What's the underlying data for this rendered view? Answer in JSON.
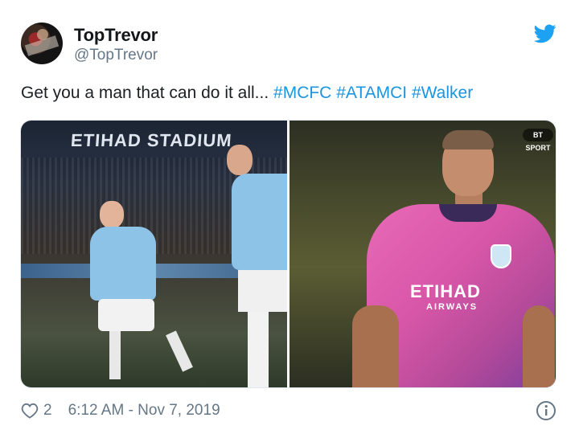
{
  "tweet": {
    "author": {
      "name": "TopTrevor",
      "handle": "@TopTrevor",
      "avatar_icon": "avatar"
    },
    "text": {
      "plain": "Get you a man that can do it all... ",
      "hashtags": [
        "#MCFC",
        "#ATAMCI",
        "#Walker"
      ]
    },
    "media": {
      "left_photo": {
        "sign_text": "ETIHAD STADIUM"
      },
      "right_photo": {
        "sponsor": "ETIHAD",
        "sponsor_sub": "AIRWAYS",
        "broadcaster_logo": "BT SPORT"
      }
    },
    "footer": {
      "like_count": "2",
      "timestamp": "6:12 AM - Nov 7, 2019"
    }
  },
  "colors": {
    "link": "#1b95e0",
    "text": "#1c2022",
    "muted": "#657786",
    "twitter_blue": "#1da1f2"
  },
  "icons": {
    "bird": "twitter-bird-icon",
    "heart": "heart-icon",
    "info": "info-icon"
  }
}
